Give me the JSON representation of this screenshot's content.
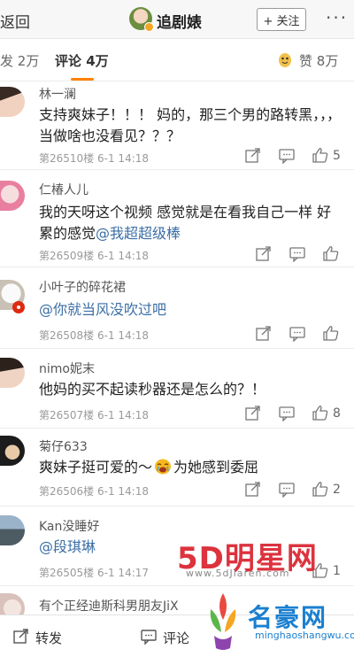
{
  "nav": {
    "back_label": "返回",
    "title": "追剧婊",
    "follow_label": "+ 关注",
    "more_label": "···"
  },
  "tabs": {
    "repost_label": "发",
    "repost_count": "2万",
    "comment_label": "评论",
    "comment_count": "4万",
    "like_label": "赞",
    "like_count": "8万"
  },
  "comments": [
    {
      "name": "林一澜",
      "text": "支持爽妹子！！！ 妈的，那三个男的路转黑，，，当做啥也没看见？？？",
      "floor": "第26510楼",
      "time": "6-1 14:18",
      "likes": "5"
    },
    {
      "name": "仁椿人儿",
      "text_pre": "我的天呀这个视频 感觉就是在看我自己一样 好累的感觉",
      "mention": "@我超超级棒",
      "floor": "第26509楼",
      "time": "6-1 14:18",
      "likes": ""
    },
    {
      "name": "小叶子的碎花裙",
      "mention": "@你就当风没吹过吧",
      "floor": "第26508楼",
      "time": "6-1 14:18",
      "likes": ""
    },
    {
      "name": "nimo妮末",
      "text": "他妈的买不起读秒器还是怎么的？！",
      "floor": "第26507楼",
      "time": "6-1 14:18",
      "likes": "8"
    },
    {
      "name": "菊仔633",
      "text_pre": "爽妹子挺可爱的～",
      "text_post": "为她感到委屈",
      "floor": "第26506楼",
      "time": "6-1 14:18",
      "likes": "2"
    },
    {
      "name": "Kan没睡好",
      "mention": "@段琪琳",
      "floor": "第26505楼",
      "time": "6-1 14:17",
      "likes": "1"
    },
    {
      "name": "有个正经迪斯科男朋友JiX"
    }
  ],
  "bottom_bar": {
    "repost_label": "转发",
    "comment_label": "评论"
  },
  "watermarks": {
    "site1": "5D明星网",
    "site1_url": "www.5dJiaren.com",
    "site2": "名豪网",
    "site2_url": "minghaoshangwu.com"
  },
  "colors": {
    "accent": "#ff8200",
    "mention": "#3b6ea5",
    "watermark_red": "#d91e2a",
    "watermark_blue": "#1a7fd0"
  }
}
